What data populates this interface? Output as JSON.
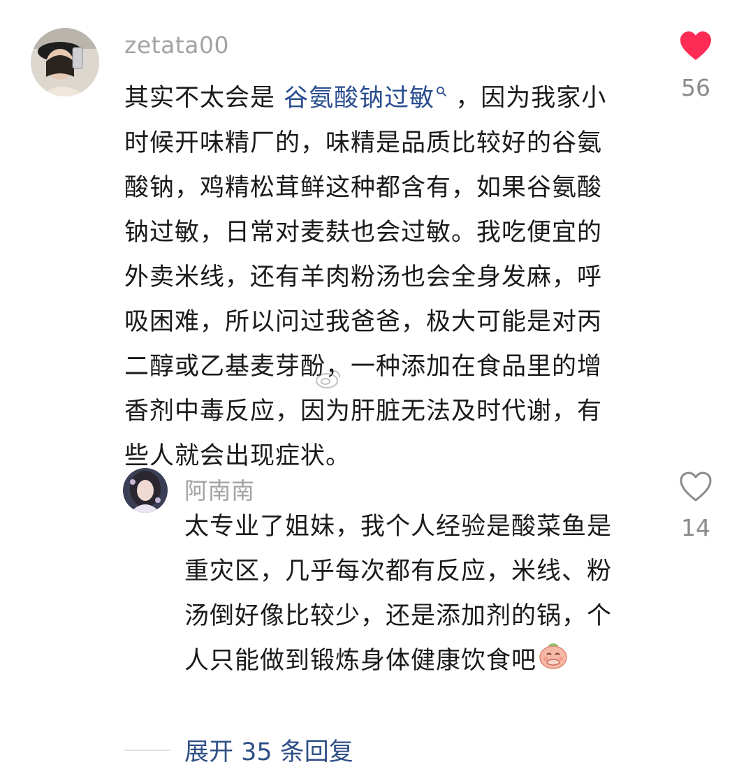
{
  "comments": [
    {
      "username": "zetata00",
      "likes": "56",
      "liked": true,
      "lines": [
        {
          "before": "其实不太会是 ",
          "link": "谷氨酸钠过敏",
          "after": " ，因为我家小"
        },
        "时候开味精厂的，味精是品质比较好的谷氨",
        "酸钠，鸡精松茸鲜这种都含有，如果谷氨酸",
        "钠过敏，日常对麦麸也会过敏。我吃便宜的",
        "外卖米线，还有羊肉粉汤也会全身发麻，呼",
        "吸困难，所以问过我爸爸，极大可能是对丙",
        "二醇或乙基麦芽酚，一种添加在食品里的增",
        "香剂中毒反应，因为肝脏无法及时代谢，有",
        "些人就会出现症状。"
      ]
    },
    {
      "username": "阿南南",
      "likes": "14",
      "liked": false,
      "lines": [
        "太专业了姐妹，我个人经验是酸菜鱼是",
        "重灾区，几乎每次都有反应，米线、粉",
        "汤倒好像比较少，还是添加剂的锅，个",
        "人只能做到锻炼身体健康饮食吧"
      ]
    }
  ],
  "expand_label": "展开 35 条回复",
  "colors": {
    "heart_liked": "#fe2c55",
    "link": "#2a4d8f",
    "expand": "#2f4f86",
    "muted": "#a3a3a3"
  }
}
